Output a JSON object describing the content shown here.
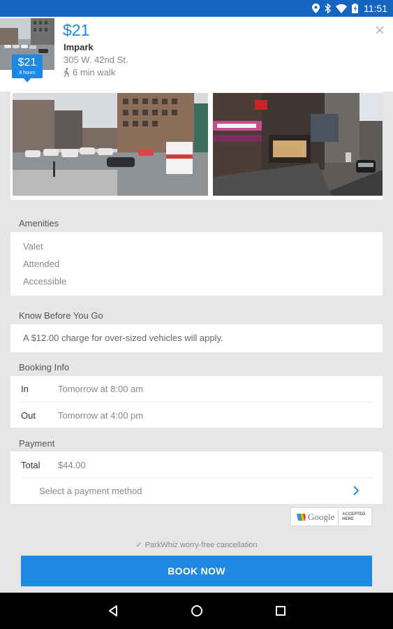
{
  "status_bar": {
    "time": "11:51",
    "icons": [
      "location-icon",
      "bluetooth-icon",
      "wifi-icon",
      "battery-icon"
    ]
  },
  "header": {
    "price": "$21",
    "tag_price": "$21",
    "tag_duration": "8 hours",
    "name": "Impark",
    "address": "305 W. 42nd St.",
    "walk": "6 min walk"
  },
  "amenities": {
    "title": "Amenities",
    "items": [
      "Valet",
      "Attended",
      "Accessible"
    ]
  },
  "know_before": {
    "title": "Know Before You Go",
    "text": "A $12.00 charge for over-sized vehicles will apply."
  },
  "booking": {
    "title": "Booking Info",
    "rows": [
      {
        "label": "In",
        "value": "Tomorrow at 8:00 am"
      },
      {
        "label": "Out",
        "value": "Tomorrow at 4:00 pm"
      }
    ]
  },
  "payment": {
    "title": "Payment",
    "total_label": "Total",
    "total_value": "$44.00",
    "method_placeholder": "Select a payment method",
    "badge_brand": "Google",
    "badge_accepted": "ACCEPTED HERE"
  },
  "footer": {
    "cancellation": "ParkWhiz worry-free cancellation",
    "book_label": "BOOK NOW"
  },
  "colors": {
    "accent": "#1e88e5",
    "status_bar": "#1565c0",
    "background": "#e6e6e6"
  }
}
